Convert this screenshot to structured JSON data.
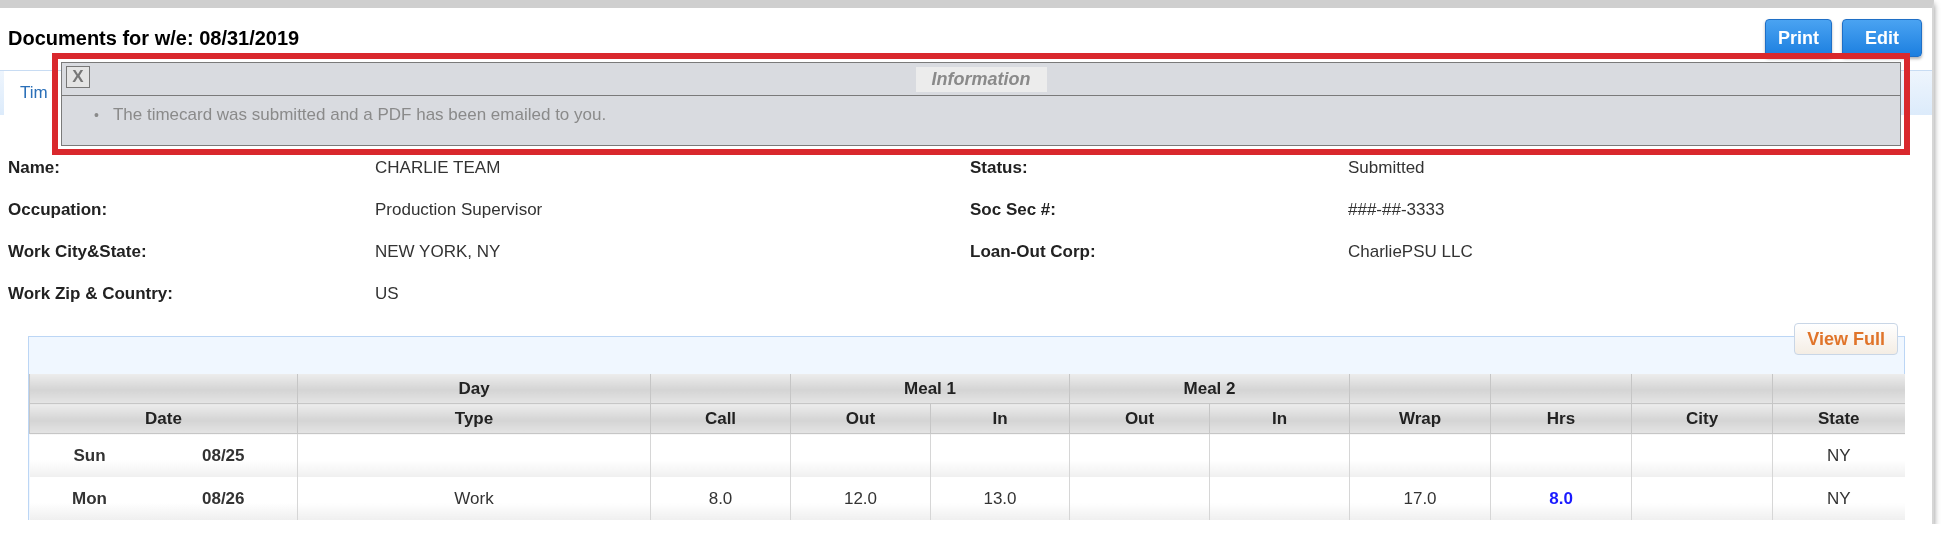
{
  "page": {
    "title": "Documents for w/e: 08/31/2019",
    "buttons": [
      {
        "label": "Print"
      },
      {
        "label": "Edit"
      }
    ]
  },
  "tabs": [
    {
      "label": "Tim",
      "selected": true
    }
  ],
  "notice": {
    "close": "X",
    "title": "Information",
    "bullet": "•",
    "messages": [
      "The timecard was submitted and a PDF has been emailed to you."
    ]
  },
  "details": {
    "left": [
      {
        "label": "Name:",
        "value": "CHARLIE TEAM"
      },
      {
        "label": "Occupation:",
        "value": "Production Supervisor"
      },
      {
        "label": "Work City&State:",
        "value": "NEW YORK,  NY"
      },
      {
        "label": "Work Zip & Country:",
        "value": "US"
      }
    ],
    "right": [
      {
        "label": "Status:",
        "value": "Submitted"
      },
      {
        "label": "Soc Sec #:",
        "value": "###-##-3333"
      },
      {
        "label": "Loan-Out Corp:",
        "value": "CharliePSU LLC"
      }
    ]
  },
  "timecard": {
    "view_full": "View Full",
    "group_headers": [
      "Day",
      "Meal 1",
      "Meal 2"
    ],
    "columns": [
      "Date",
      "Type",
      "Call",
      "Out",
      "In",
      "Out",
      "In",
      "Wrap",
      "Hrs",
      "City",
      "State"
    ],
    "rows": [
      {
        "day": "Sun",
        "date": "08/25",
        "state": "NY"
      },
      {
        "day": "Mon",
        "date": "08/26",
        "type": "Work",
        "call": "8.0",
        "m1_out": "12.0",
        "m1_in": "13.0",
        "wrap": "17.0",
        "hrs": "8.0",
        "state": "NY"
      }
    ]
  }
}
